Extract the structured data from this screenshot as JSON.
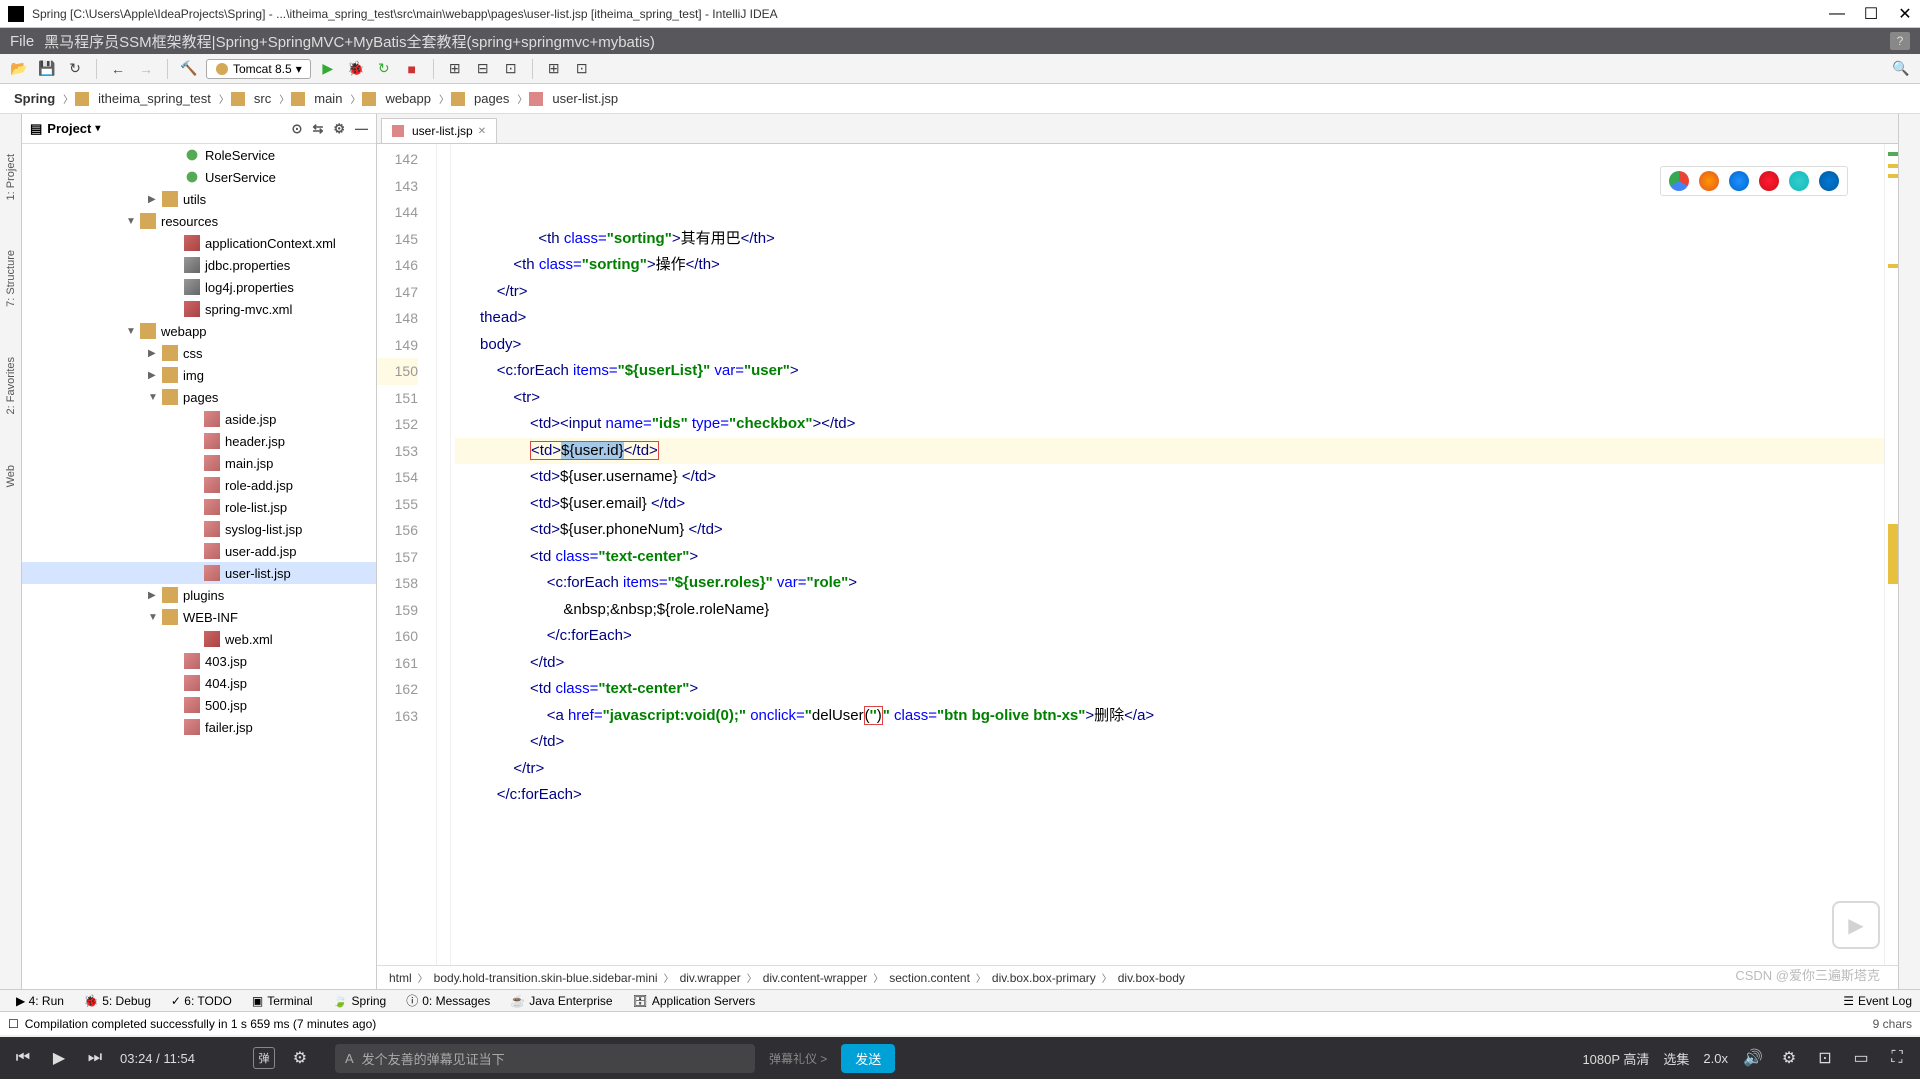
{
  "titlebar": {
    "text": "Spring [C:\\Users\\Apple\\IdeaProjects\\Spring] - ...\\itheima_spring_test\\src\\main\\webapp\\pages\\user-list.jsp [itheima_spring_test] - IntelliJ IDEA"
  },
  "menubar": {
    "text": "黑马程序员SSM框架教程|Spring+SpringMVC+MyBatis全套教程(spring+springmvc+mybatis)"
  },
  "toolbar": {
    "run_config": "Tomcat 8.5"
  },
  "breadcrumb": {
    "items": [
      "Spring",
      "itheima_spring_test",
      "src",
      "main",
      "webapp",
      "pages",
      "user-list.jsp"
    ]
  },
  "left_strip": {
    "labels": [
      "1: Project",
      "7: Structure",
      "2: Favorites",
      "Web"
    ]
  },
  "project_panel": {
    "title": "Project",
    "tree": [
      {
        "indent": 140,
        "icon": "interface",
        "label": "RoleService"
      },
      {
        "indent": 140,
        "icon": "interface",
        "label": "UserService"
      },
      {
        "indent": 118,
        "arrow": "▶",
        "icon": "folder",
        "label": "utils"
      },
      {
        "indent": 96,
        "arrow": "▼",
        "icon": "folder",
        "label": "resources"
      },
      {
        "indent": 140,
        "icon": "xml",
        "label": "applicationContext.xml"
      },
      {
        "indent": 140,
        "icon": "prop",
        "label": "jdbc.properties"
      },
      {
        "indent": 140,
        "icon": "prop",
        "label": "log4j.properties"
      },
      {
        "indent": 140,
        "icon": "xml",
        "label": "spring-mvc.xml"
      },
      {
        "indent": 96,
        "arrow": "▼",
        "icon": "folder",
        "label": "webapp"
      },
      {
        "indent": 118,
        "arrow": "▶",
        "icon": "folder",
        "label": "css"
      },
      {
        "indent": 118,
        "arrow": "▶",
        "icon": "folder",
        "label": "img"
      },
      {
        "indent": 118,
        "arrow": "▼",
        "icon": "folder",
        "label": "pages"
      },
      {
        "indent": 160,
        "icon": "jsp",
        "label": "aside.jsp"
      },
      {
        "indent": 160,
        "icon": "jsp",
        "label": "header.jsp"
      },
      {
        "indent": 160,
        "icon": "jsp",
        "label": "main.jsp"
      },
      {
        "indent": 160,
        "icon": "jsp",
        "label": "role-add.jsp"
      },
      {
        "indent": 160,
        "icon": "jsp",
        "label": "role-list.jsp"
      },
      {
        "indent": 160,
        "icon": "jsp",
        "label": "syslog-list.jsp"
      },
      {
        "indent": 160,
        "icon": "jsp",
        "label": "user-add.jsp"
      },
      {
        "indent": 160,
        "icon": "jsp",
        "label": "user-list.jsp",
        "selected": true
      },
      {
        "indent": 118,
        "arrow": "▶",
        "icon": "folder",
        "label": "plugins"
      },
      {
        "indent": 118,
        "arrow": "▼",
        "icon": "folder",
        "label": "WEB-INF"
      },
      {
        "indent": 160,
        "icon": "xml",
        "label": "web.xml"
      },
      {
        "indent": 140,
        "icon": "jsp",
        "label": "403.jsp"
      },
      {
        "indent": 140,
        "icon": "jsp",
        "label": "404.jsp"
      },
      {
        "indent": 140,
        "icon": "jsp",
        "label": "500.jsp"
      },
      {
        "indent": 140,
        "icon": "jsp",
        "label": "failer.jsp"
      }
    ]
  },
  "editor": {
    "tab": "user-list.jsp",
    "line_start": 142,
    "lines": [
      {
        "n": 142,
        "html": "                    <span class='tag'>&lt;th</span> <span class='attr-name'>class=</span><span class='attr-val'>\"sorting\"</span><span class='tag'>&gt;</span>其有用巴<span class='tag'>&lt;/th&gt;</span>"
      },
      {
        "n": 143,
        "html": "              <span class='tag'>&lt;th</span> <span class='attr-name'>class=</span><span class='attr-val'>\"sorting\"</span><span class='tag'>&gt;</span>操作<span class='tag'>&lt;/th&gt;</span>"
      },
      {
        "n": 144,
        "html": "          <span class='tag'>&lt;/tr&gt;</span>"
      },
      {
        "n": 145,
        "html": "      <span class='tag'>thead&gt;</span>"
      },
      {
        "n": 146,
        "html": "      <span class='tag'>body&gt;</span>"
      },
      {
        "n": 147,
        "html": "          <span class='tag'>&lt;c:forEach</span> <span class='attr-name'>items=</span><span class='attr-val'>\"${userList}\"</span> <span class='attr-name'>var=</span><span class='attr-val'>\"user\"</span><span class='tag'>&gt;</span>"
      },
      {
        "n": 148,
        "html": "              <span class='tag'>&lt;tr&gt;</span>"
      },
      {
        "n": 149,
        "html": "                  <span class='tag'>&lt;td&gt;</span><span class='tag'>&lt;input</span> <span class='attr-name'>name=</span><span class='attr-val'>\"ids\"</span> <span class='attr-name'>type=</span><span class='attr-val'>\"checkbox\"</span><span class='tag'>&gt;&lt;/td&gt;</span>"
      },
      {
        "n": 150,
        "hl": true,
        "html": "                  <span class='red-box'><span class='tag'>&lt;td&gt;</span><span class='selected-text'>${user.id}</span><span class='tag'>&lt;/td&gt;</span></span>"
      },
      {
        "n": 151,
        "html": "                  <span class='tag'>&lt;td&gt;</span>${user.username} <span class='tag'>&lt;/td&gt;</span>"
      },
      {
        "n": 152,
        "html": "                  <span class='tag'>&lt;td&gt;</span>${user.email} <span class='tag'>&lt;/td&gt;</span>"
      },
      {
        "n": 153,
        "html": "                  <span class='tag'>&lt;td&gt;</span>${user.phoneNum} <span class='tag'>&lt;/td&gt;</span>"
      },
      {
        "n": 154,
        "html": "                  <span class='tag'>&lt;td</span> <span class='attr-name'>class=</span><span class='attr-val'>\"text-center\"</span><span class='tag'>&gt;</span>"
      },
      {
        "n": 155,
        "html": "                      <span class='tag'>&lt;c:forEach</span> <span class='attr-name'>items=</span><span class='attr-val'>\"${user.roles}\"</span> <span class='attr-name'>var=</span><span class='attr-val'>\"role\"</span><span class='tag'>&gt;</span>"
      },
      {
        "n": 156,
        "html": "                          &amp;nbsp;&amp;nbsp;${role.roleName}"
      },
      {
        "n": 157,
        "html": "                      <span class='tag'>&lt;/c:forEach&gt;</span>"
      },
      {
        "n": 158,
        "html": "                  <span class='tag'>&lt;/td&gt;</span>"
      },
      {
        "n": 159,
        "html": "                  <span class='tag'>&lt;td</span> <span class='attr-name'>class=</span><span class='attr-val'>\"text-center\"</span><span class='tag'>&gt;</span>"
      },
      {
        "n": 160,
        "html": "                      <span class='tag'>&lt;a</span> <span class='attr-name'>href=</span><span class='attr-val'>\"javascript:void(0);\"</span> <span class='attr-name'>onclick=</span><span class='attr-val'>\"</span>delUser<span class='red-box'>(<span class='attr-val'>''</span>)</span><span class='attr-val'>\"</span> <span class='attr-name'>class=</span><span class='attr-val'>\"btn bg-olive btn-xs\"</span><span class='tag'>&gt;</span>删除<span class='tag'>&lt;/a&gt;</span>"
      },
      {
        "n": 161,
        "html": "                  <span class='tag'>&lt;/td&gt;</span>"
      },
      {
        "n": 162,
        "html": "              <span class='tag'>&lt;/tr&gt;</span>"
      },
      {
        "n": 163,
        "html": "          <span class='tag'>&lt;/c:forEach&gt;</span>"
      }
    ],
    "bottom_breadcrumb": [
      "html",
      "body.hold-transition.skin-blue.sidebar-mini",
      "div.wrapper",
      "div.content-wrapper",
      "section.content",
      "div.box.box-primary",
      "div.box-body"
    ]
  },
  "bottom_tabs": {
    "items": [
      "▶ 4: Run",
      "🐞 5: Debug",
      "✓ 6: TODO",
      "Terminal",
      "Spring",
      "0: Messages",
      "Java Enterprise",
      "Application Servers"
    ],
    "right": "Event Log"
  },
  "statusbar": {
    "msg": "Compilation completed successfully in 1 s 659 ms (7 minutes ago)",
    "right": "9 chars"
  },
  "video": {
    "time": "03:24 / 11:54",
    "danmu_placeholder": "发个友善的弹幕见证当下",
    "danmu_gift": "弹幕礼仪 >",
    "send": "发送",
    "quality": "1080P 高清",
    "speed_label": "选集",
    "speed": "2.0x"
  },
  "watermark": "CSDN @爱你三遍斯塔克"
}
